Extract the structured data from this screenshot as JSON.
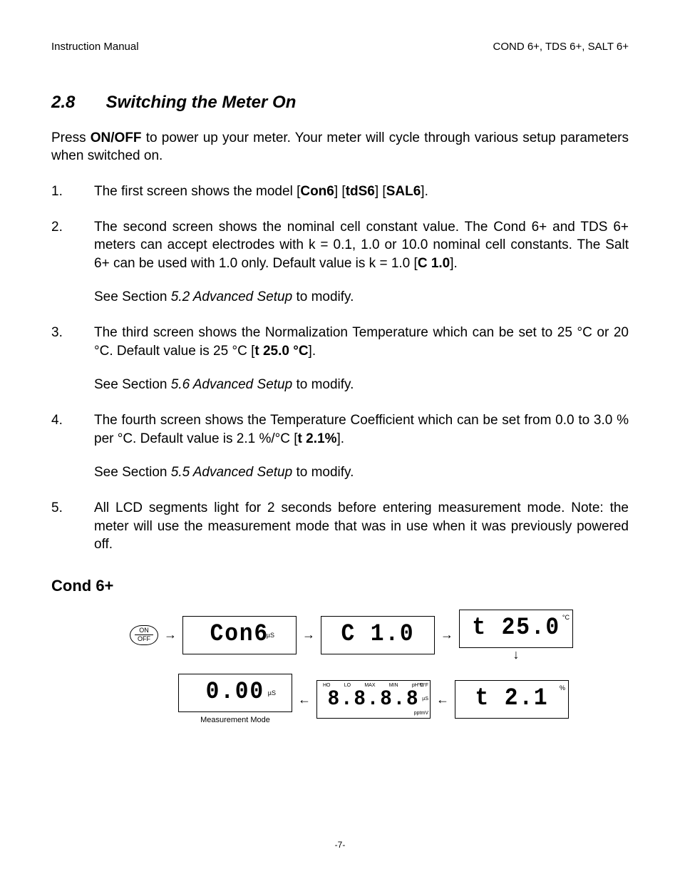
{
  "header": {
    "left": "Instruction Manual",
    "right": "COND 6+, TDS 6+, SALT 6+"
  },
  "section": {
    "number": "2.8",
    "title": "Switching the Meter On"
  },
  "intro": {
    "pre": "Press ",
    "bold": "ON/OFF",
    "post": " to power up your meter. Your meter will cycle through various setup parameters when switched on."
  },
  "steps": [
    {
      "n": "1.",
      "runs": [
        {
          "t": "The first screen shows the model ["
        },
        {
          "t": "Con6",
          "b": true
        },
        {
          "t": "] ["
        },
        {
          "t": "tdS6",
          "b": true
        },
        {
          "t": "] ["
        },
        {
          "t": "SAL6",
          "b": true
        },
        {
          "t": "]."
        }
      ]
    },
    {
      "n": "2.",
      "runs": [
        {
          "t": "The second screen shows the nominal cell constant value. The Cond 6+ and TDS 6+ meters can accept electrodes with k = 0.1, 1.0 or 10.0 nominal cell constants. The Salt 6+ can be used with 1.0 only. Default value is k = 1.0 ["
        },
        {
          "t": "C 1.0",
          "b": true
        },
        {
          "t": "]."
        }
      ],
      "sub_runs": [
        {
          "t": "See Section "
        },
        {
          "t": "5.2 Advanced Setup",
          "i": true
        },
        {
          "t": " to modify."
        }
      ]
    },
    {
      "n": "3.",
      "runs": [
        {
          "t": "The third screen shows the Normalization Temperature which can be set to 25 °C or 20 °C. Default value is 25 °C ["
        },
        {
          "t": "t 25.0 °C",
          "b": true
        },
        {
          "t": "]."
        }
      ],
      "sub_runs": [
        {
          "t": "See Section "
        },
        {
          "t": "5.6 Advanced Setup",
          "i": true
        },
        {
          "t": " to modify."
        }
      ]
    },
    {
      "n": "4.",
      "runs": [
        {
          "t": "The fourth screen shows the Temperature Coefficient which can be set from 0.0 to 3.0 % per °C. Default value is 2.1 %/°C ["
        },
        {
          "t": "t 2.1%",
          "b": true
        },
        {
          "t": "]."
        }
      ],
      "sub_runs": [
        {
          "t": "See Section "
        },
        {
          "t": "5.5 Advanced Setup",
          "i": true
        },
        {
          "t": " to modify."
        }
      ]
    },
    {
      "n": "5.",
      "runs": [
        {
          "t": "All LCD segments light for 2 seconds before entering measurement mode. Note: the meter will use the measurement mode that was in use when it was previously powered off."
        }
      ]
    }
  ],
  "sub_heading": "Cond 6+",
  "diagram": {
    "on_top": "ON",
    "on_bot": "OFF",
    "arrow": "→",
    "arrow_down": "↓",
    "arrow_left": "←",
    "s1": {
      "main": "Con6",
      "unit": "µS"
    },
    "s2": {
      "main": "C  1.0"
    },
    "s3": {
      "main": "t 25.0",
      "unit": "°C"
    },
    "s4": {
      "main": "t  2.1",
      "unit": "%"
    },
    "s5": {
      "main": "8.8.8.8",
      "top": [
        "HO",
        "LO",
        "MAX",
        "MIN",
        "pH %"
      ],
      "side": [
        "°C°F",
        "µS",
        "pptmV"
      ]
    },
    "s6": {
      "main": "0.00",
      "unit": "µS",
      "caption": "Measurement Mode"
    }
  },
  "footer": "-7-"
}
